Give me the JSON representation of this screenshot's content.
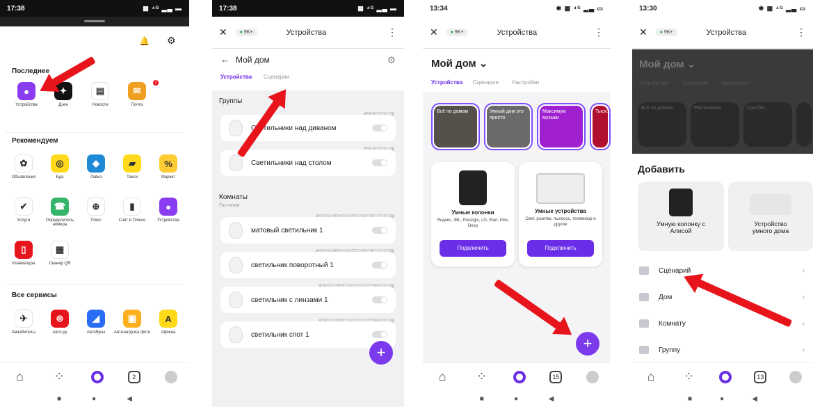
{
  "colors": {
    "accent": "#6b2ee8",
    "arrow": "#e8141c"
  },
  "p1": {
    "time": "17:38",
    "status": "▦ ⁴ᴳ ▂▃ ▬",
    "bell": "🔔",
    "gear": "⚙",
    "sec_recent": "Последнее",
    "recent": [
      {
        "label": "Устройства",
        "color": "#8a3cf0",
        "glyph": "●"
      },
      {
        "label": "Дзен",
        "color": "#111111",
        "glyph": "✦"
      },
      {
        "label": "Новости",
        "color": "#ffffff",
        "glyph": "▤"
      },
      {
        "label": "Почта",
        "color": "#f0a020",
        "glyph": "✉",
        "badge": "2"
      }
    ],
    "sec_recommend": "Рекомендуем",
    "recommend": [
      {
        "label": "Объявления",
        "color": "#ffffff",
        "glyph": "✿"
      },
      {
        "label": "Еда",
        "color": "#ffd91a",
        "glyph": "◎"
      },
      {
        "label": "Лавка",
        "color": "#1e8ad6",
        "glyph": "◆"
      },
      {
        "label": "Такси",
        "color": "#ffd91a",
        "glyph": "▰"
      },
      {
        "label": "Маркет",
        "color": "#ffcc33",
        "glyph": "%"
      },
      {
        "label": "Услуги",
        "color": "#ffffff",
        "glyph": "✔"
      },
      {
        "label": "Определитель номера",
        "color": "#35b56a",
        "glyph": "☎"
      },
      {
        "label": "Плюс",
        "color": "#ffffff",
        "glyph": "⊕"
      },
      {
        "label": "Счёт в Плюсе",
        "color": "#ffffff",
        "glyph": "▮"
      },
      {
        "label": "Устройства",
        "color": "#8a3cf0",
        "glyph": "●"
      },
      {
        "label": "Клавиатура",
        "color": "#e8141c",
        "glyph": "▯"
      },
      {
        "label": "Сканер QR",
        "color": "#ffffff",
        "glyph": "▦"
      }
    ],
    "sec_all": "Все сервисы",
    "all": [
      {
        "label": "Авиабилеты",
        "color": "#ffffff",
        "glyph": "✈"
      },
      {
        "label": "Авто.ру",
        "color": "#e8141c",
        "glyph": "⊜"
      },
      {
        "label": "Автобусы",
        "color": "#2a6df5",
        "glyph": "◢"
      },
      {
        "label": "Автозагрузка фото",
        "color": "#ffb020",
        "glyph": "▣"
      },
      {
        "label": "Афиша",
        "color": "#ffd91a",
        "glyph": "A"
      }
    ]
  },
  "p2": {
    "time": "17:38",
    "status": "▦ ⁴ᴳ ▂▃ ▬",
    "close": "✕",
    "pill_dot": "●",
    "pill": "9K+",
    "title": "Устройства",
    "more": "⋮",
    "back": "←",
    "home": "Мой дом",
    "gear": "⚙",
    "tab_devices": "Устройства",
    "tab_scenes": "Сценарии",
    "groups": "Группы",
    "group_items": [
      {
        "name": "Светильники над диваном",
        "tag": "2 устройства"
      },
      {
        "name": "Светильники над столом",
        "tag": "2 устройства"
      }
    ],
    "rooms": "Комнаты",
    "room": "Гостиная",
    "room_items": [
      {
        "name": "матовый светильник 1",
        "tag": "в группе «Светильники над диваном»"
      },
      {
        "name": "светильник поворотный 1",
        "tag": "в группе «Светильники над диваном»"
      },
      {
        "name": "светильник с линзами 1",
        "tag": "в группе «Светильники над столом»"
      },
      {
        "name": "светильник спот 1",
        "tag": "в группе «Светильники над столом»"
      }
    ],
    "fab": "+"
  },
  "p3": {
    "time": "13:34",
    "status": "✱ ▦ ⁴ᴳ ▂▃ ▭",
    "close": "✕",
    "pill_dot": "●",
    "pill": "9K+",
    "title": "Устройства",
    "more": "⋮",
    "home": "Мой дом ⌄",
    "tabs": [
      "Устройства",
      "Сценарии",
      "Настройки"
    ],
    "stories": [
      {
        "text": "Всё по домам",
        "color": "#55504a"
      },
      {
        "text": "Умный дом это просто",
        "color": "#6a6a6a"
      },
      {
        "text": "Максимум музыки",
        "color": "#a020d0"
      },
      {
        "text": "Тыся...",
        "color": "#b01030"
      }
    ],
    "cards": [
      {
        "title": "Умные колонки",
        "sub": "Яндекс, JBL, Prestigio, LG, Elari, Irbis, Dexp",
        "btn": "Подключить"
      },
      {
        "title": "Умные устройства",
        "sub": "Свет, розетки, пылесос, телевизор и другие",
        "btn": "Подключить"
      }
    ],
    "fab": "+",
    "nav_cal": "15"
  },
  "p4": {
    "time": "13:30",
    "status": "✱ ▦ ⁴ᴳ ▂▃ ▭",
    "close": "✕",
    "pill_dot": "●",
    "pill": "9K+",
    "title": "Устройства",
    "more": "⋮",
    "home": "Мой дом ⌄",
    "tabs": [
      "Устройства",
      "Сценарии",
      "Настройки"
    ],
    "stories": [
      "Всё по домам",
      "Расписания",
      "Сон без...",
      ""
    ],
    "add": "Добавить",
    "tiles": [
      "Умную колонку с Алисой",
      "Устройство умного дома"
    ],
    "rows": [
      "Сценарий",
      "Дом",
      "Комнату",
      "Группу"
    ],
    "chev": "›",
    "nav_cal": "13"
  },
  "nav": {
    "home": "⌂",
    "services": "⁘",
    "cal": "2",
    "sys_back": "◀",
    "sys_home": "●",
    "sys_recent": "■"
  }
}
